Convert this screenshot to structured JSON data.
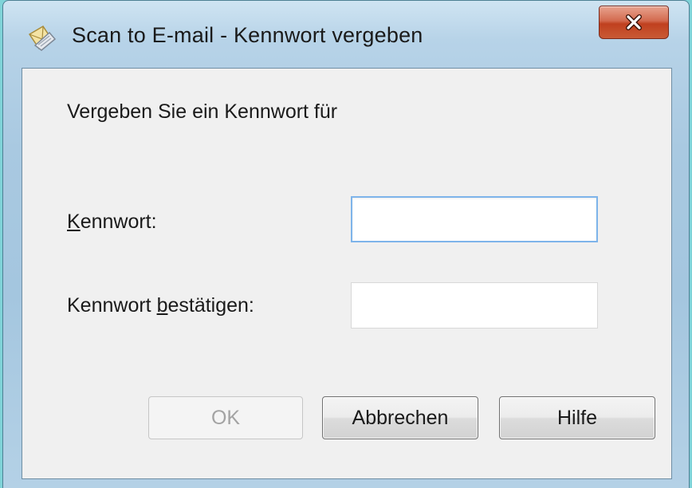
{
  "window": {
    "title": "Scan to E-mail - Kennwort vergeben",
    "app_icon": "scan-envelope-icon",
    "close_icon": "close-icon"
  },
  "dialog": {
    "prompt": "Vergeben Sie ein Kennwort für",
    "fields": [
      {
        "label_accesskey": "K",
        "label_rest": "ennwort:",
        "value": ""
      },
      {
        "label_before": "Kennwort ",
        "label_accesskey": "b",
        "label_rest": "estätigen:",
        "value": ""
      }
    ]
  },
  "buttons": {
    "ok": "OK",
    "ok_enabled": false,
    "cancel": "Abbrechen",
    "help": "Hilfe"
  },
  "colors": {
    "desktop": "#7fd3d8",
    "close_button": "#c9482a",
    "focus_border": "#7eb4ea",
    "disabled_text": "#a3a3a3"
  }
}
